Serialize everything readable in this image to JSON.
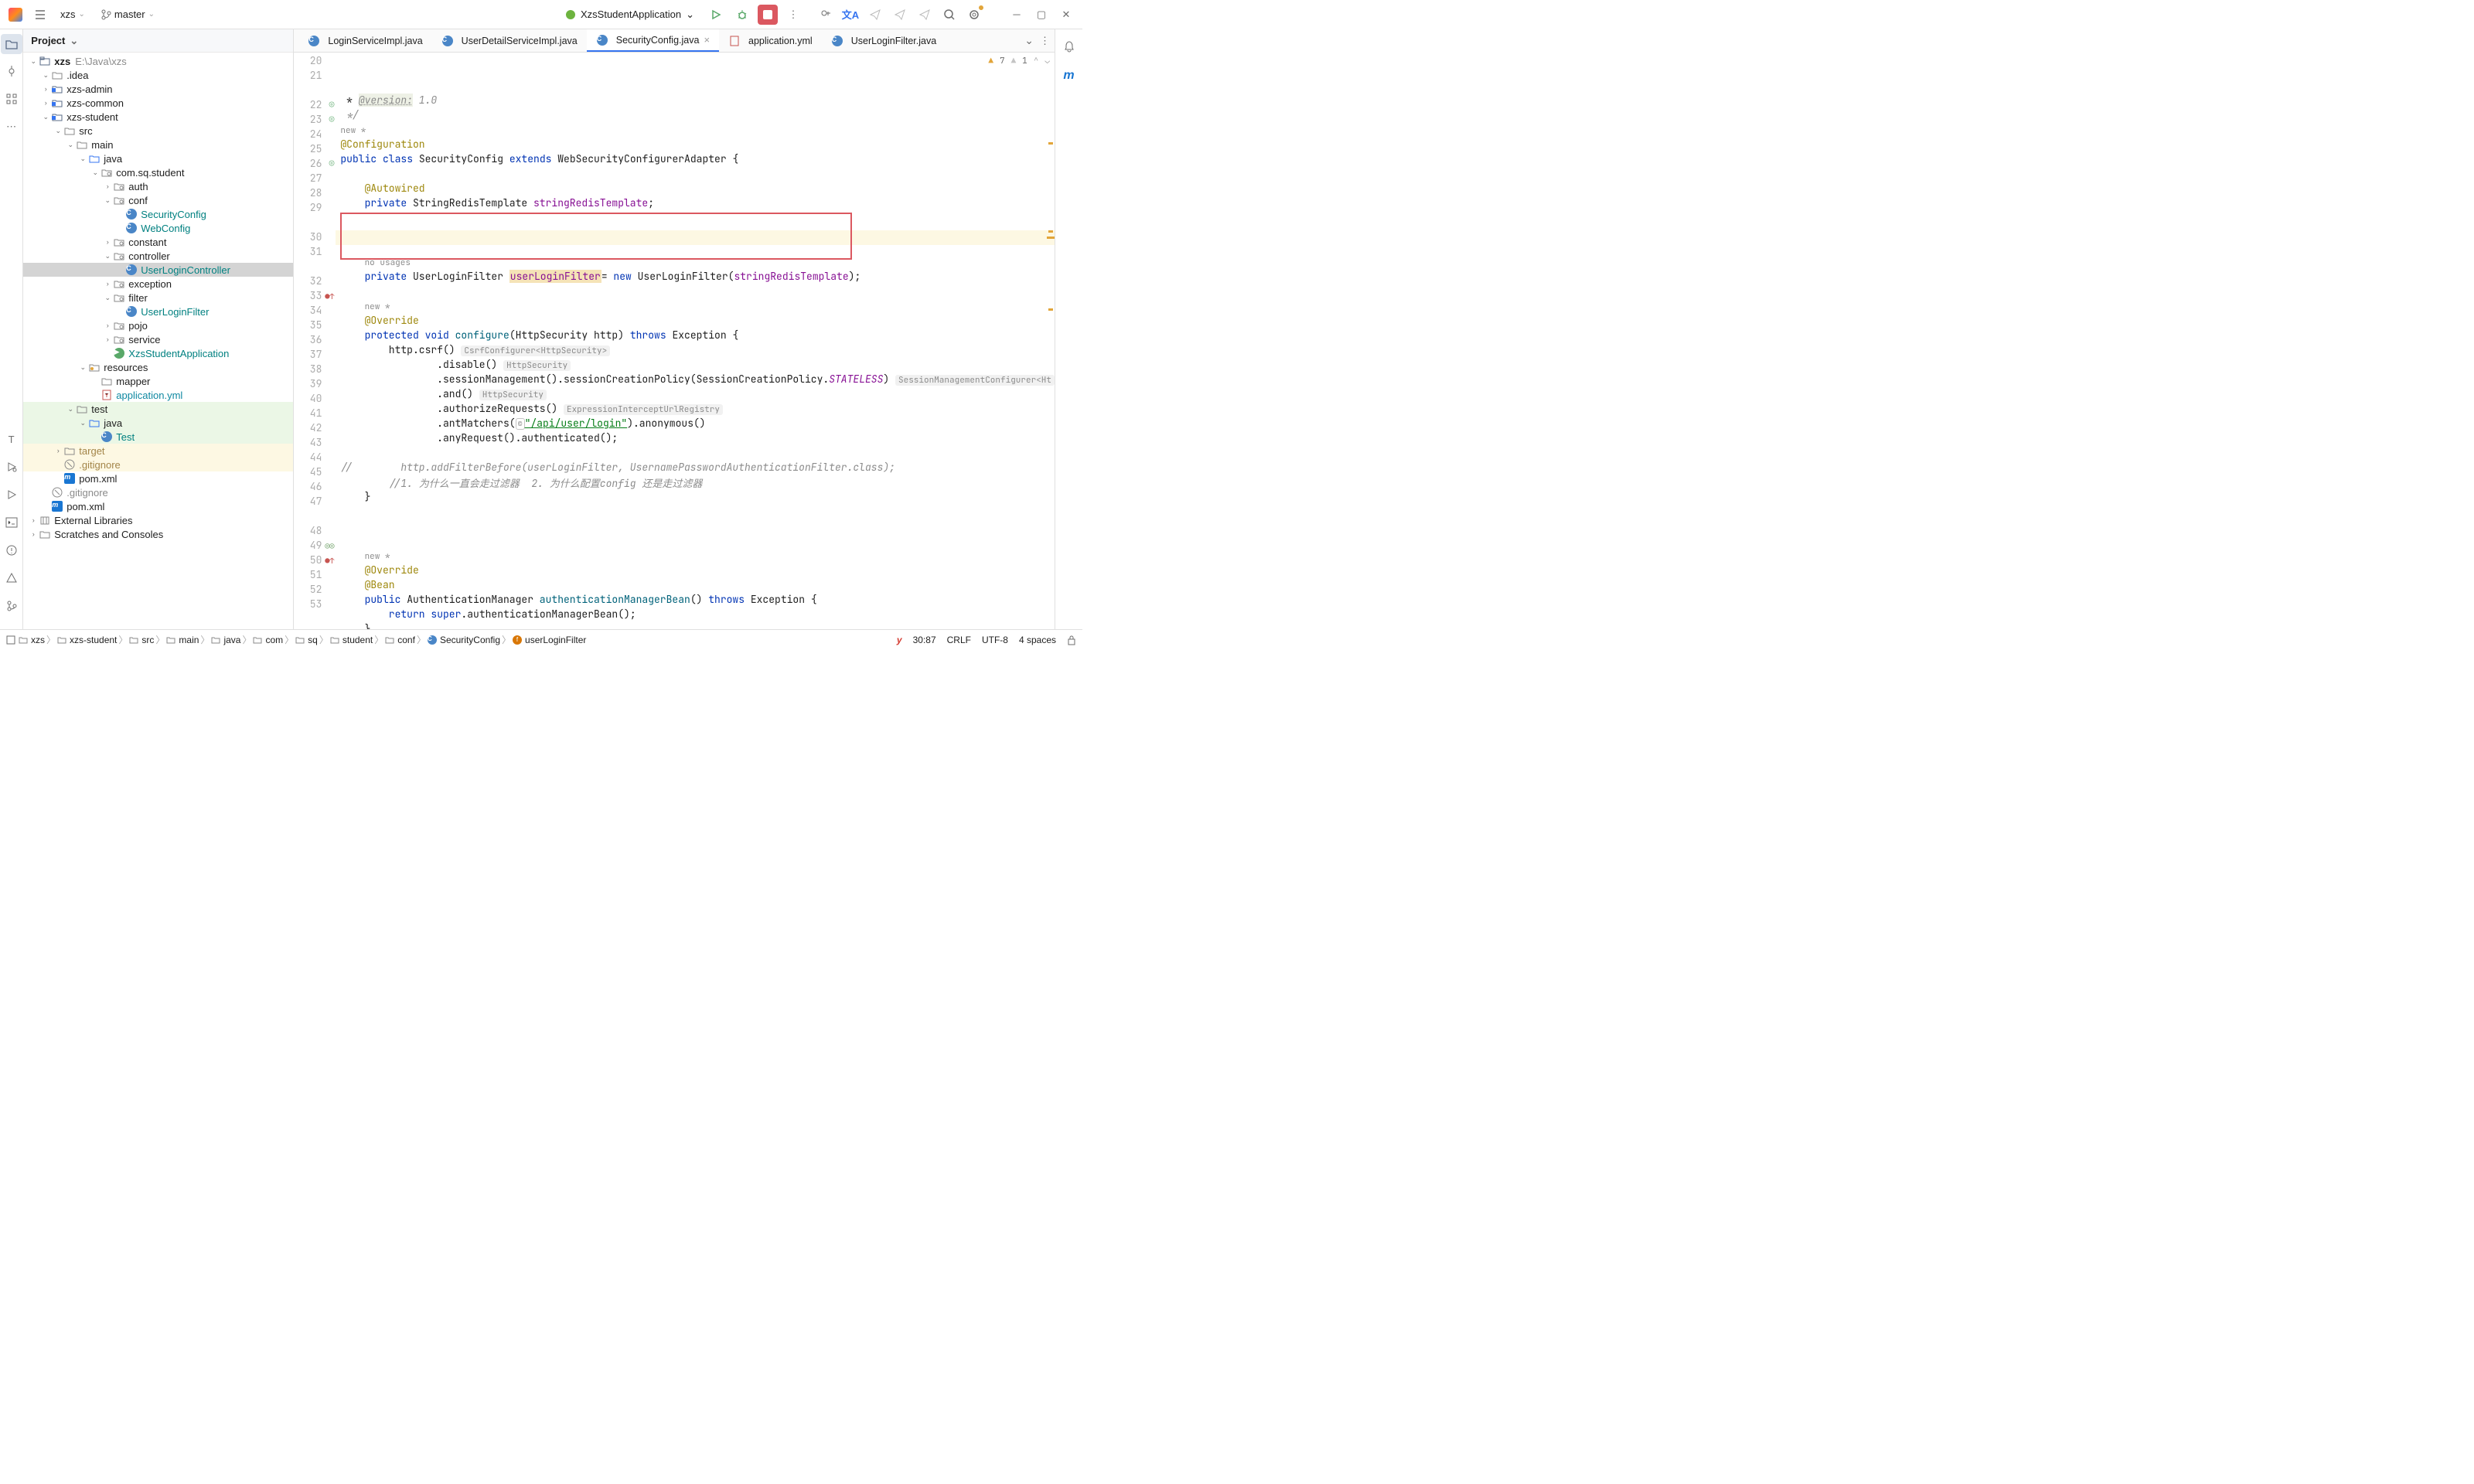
{
  "toolbar": {
    "project_name": "xzs",
    "branch": "master",
    "run_config": "XzsStudentApplication"
  },
  "project_panel": {
    "title": "Project",
    "root_label": "xzs",
    "root_path": "E:\\Java\\xzs",
    "external_libs": "External Libraries",
    "scratches": "Scratches and Consoles"
  },
  "tree": [
    {
      "d": 1,
      "a": "v",
      "ic": "folder",
      "txt": ".idea",
      "cls": ""
    },
    {
      "d": 1,
      "a": ">",
      "ic": "mod",
      "txt": "xzs-admin",
      "cls": ""
    },
    {
      "d": 1,
      "a": ">",
      "ic": "mod",
      "txt": "xzs-common",
      "cls": ""
    },
    {
      "d": 1,
      "a": "v",
      "ic": "mod",
      "txt": "xzs-student",
      "cls": ""
    },
    {
      "d": 2,
      "a": "v",
      "ic": "folder",
      "txt": "src",
      "cls": ""
    },
    {
      "d": 3,
      "a": "v",
      "ic": "folder",
      "txt": "main",
      "cls": ""
    },
    {
      "d": 4,
      "a": "v",
      "ic": "srcfolder",
      "txt": "java",
      "cls": ""
    },
    {
      "d": 5,
      "a": "v",
      "ic": "pkg",
      "txt": "com.sq.student",
      "cls": ""
    },
    {
      "d": 6,
      "a": ">",
      "ic": "pkg",
      "txt": "auth",
      "cls": ""
    },
    {
      "d": 6,
      "a": "v",
      "ic": "pkg",
      "txt": "conf",
      "cls": ""
    },
    {
      "d": 7,
      "a": "",
      "ic": "class",
      "txt": "SecurityConfig",
      "cls": "teal"
    },
    {
      "d": 7,
      "a": "",
      "ic": "class",
      "txt": "WebConfig",
      "cls": "teal"
    },
    {
      "d": 6,
      "a": ">",
      "ic": "pkg",
      "txt": "constant",
      "cls": ""
    },
    {
      "d": 6,
      "a": "v",
      "ic": "pkg",
      "txt": "controller",
      "cls": ""
    },
    {
      "d": 7,
      "a": "",
      "ic": "class",
      "txt": "UserLoginController",
      "cls": "teal selected"
    },
    {
      "d": 6,
      "a": ">",
      "ic": "pkg",
      "txt": "exception",
      "cls": ""
    },
    {
      "d": 6,
      "a": "v",
      "ic": "pkg",
      "txt": "filter",
      "cls": ""
    },
    {
      "d": 7,
      "a": "",
      "ic": "class",
      "txt": "UserLoginFilter",
      "cls": "teal"
    },
    {
      "d": 6,
      "a": ">",
      "ic": "pkg",
      "txt": "pojo",
      "cls": ""
    },
    {
      "d": 6,
      "a": ">",
      "ic": "pkg",
      "txt": "service",
      "cls": ""
    },
    {
      "d": 6,
      "a": "",
      "ic": "app",
      "txt": "XzsStudentApplication",
      "cls": "teal"
    },
    {
      "d": 4,
      "a": "v",
      "ic": "resfolder",
      "txt": "resources",
      "cls": ""
    },
    {
      "d": 5,
      "a": "",
      "ic": "folder",
      "txt": "mapper",
      "cls": ""
    },
    {
      "d": 5,
      "a": "",
      "ic": "yaml",
      "txt": "application.yml",
      "cls": "cyan"
    },
    {
      "d": 3,
      "a": "v",
      "ic": "folder",
      "txt": "test",
      "cls": "green"
    },
    {
      "d": 4,
      "a": "v",
      "ic": "srcfolder",
      "txt": "java",
      "cls": "green"
    },
    {
      "d": 5,
      "a": "",
      "ic": "class",
      "txt": "Test",
      "cls": "teal green"
    },
    {
      "d": 2,
      "a": ">",
      "ic": "folder",
      "txt": "target",
      "cls": "ignored yellow"
    },
    {
      "d": 2,
      "a": "",
      "ic": "git",
      "txt": ".gitignore",
      "cls": "ignored yellow"
    },
    {
      "d": 2,
      "a": "",
      "ic": "maven",
      "txt": "pom.xml",
      "cls": ""
    },
    {
      "d": 1,
      "a": "",
      "ic": "git",
      "txt": ".gitignore",
      "cls": "grey"
    },
    {
      "d": 1,
      "a": "",
      "ic": "maven",
      "txt": "pom.xml",
      "cls": ""
    }
  ],
  "tabs": [
    {
      "label": "LoginServiceImpl.java",
      "icon": "class",
      "active": false
    },
    {
      "label": "UserDetailServiceImpl.java",
      "icon": "class",
      "active": false
    },
    {
      "label": "SecurityConfig.java",
      "icon": "class",
      "active": true
    },
    {
      "label": "application.yml",
      "icon": "yaml",
      "active": false
    },
    {
      "label": "UserLoginFilter.java",
      "icon": "class",
      "active": false
    }
  ],
  "inspections": {
    "warnings": "7",
    "weak": "1"
  },
  "code_lines": [
    {
      "n": 20,
      "html": " * <span style='background:#eef1e6;color:#8c8c8c;text-decoration:underline dotted;font-style:italic'>@version:</span><span class='com'> 1.0</span>"
    },
    {
      "n": 21,
      "html": "<span class='com'> */</span>"
    },
    {
      "n": null,
      "html": "<span class='newstar'>new *</span>"
    },
    {
      "n": 22,
      "gut": "green-run",
      "html": "<span class='ann'>@Configuration</span>"
    },
    {
      "n": 23,
      "gut": "green-run",
      "html": "<span class='kw'>public</span> <span class='kw'>class</span> SecurityConfig <span class='kw'>extends</span> WebSecurityConfigurerAdapter {"
    },
    {
      "n": 24,
      "html": ""
    },
    {
      "n": 25,
      "html": "    <span class='ann'>@Autowired</span>"
    },
    {
      "n": 26,
      "gut": "green-run",
      "html": "    <span class='kw'>private</span> StringRedisTemplate <span class='field'>stringRedisTemplate</span>;"
    },
    {
      "n": 27,
      "html": ""
    },
    {
      "n": 28,
      "html": ""
    },
    {
      "n": 29,
      "html": ""
    },
    {
      "n": null,
      "hl": true,
      "html": "    <span class='usages'>no usages</span>"
    },
    {
      "n": 30,
      "hl": true,
      "bulb": true,
      "html": "    <span class='kw'>private</span> UserLoginFilter <span class='hl-token field'>userLoginFilter</span>= <span class='kw'>new</span> UserLoginFilter(<span class='field'>stringRedisTemplate</span>);",
      "lineY": true
    },
    {
      "n": 31,
      "hl": true,
      "html": ""
    },
    {
      "n": null,
      "html": "    <span class='newstar'>new *</span>"
    },
    {
      "n": 32,
      "html": "    <span class='ann'>@Override</span>"
    },
    {
      "n": 33,
      "gut": "impl",
      "html": "    <span class='kw'>protected</span> <span class='kw'>void</span> <span class='method'>configure</span>(HttpSecurity http) <span class='kw'>throws</span> Exception {"
    },
    {
      "n": 34,
      "html": "        http.csrf() <span class='hint'>CsrfConfigurer&lt;HttpSecurity&gt;</span>"
    },
    {
      "n": 35,
      "html": "                .disable() <span class='hint'>HttpSecurity</span>"
    },
    {
      "n": 36,
      "html": "                .sessionManagement().sessionCreationPolicy(SessionCreationPolicy.<span class='field' style='font-style:italic'>STATELESS</span>) <span class='hint'>SessionManagementConfigurer&lt;Ht</span>"
    },
    {
      "n": 37,
      "html": "                .and() <span class='hint'>HttpSecurity</span>"
    },
    {
      "n": 38,
      "html": "                .authorizeRequests() <span class='hint'>ExpressionInterceptUrlRegistry</span>"
    },
    {
      "n": 39,
      "html": "                .antMatchers(<span style='border:1px solid #c4c4c4;border-radius:3px;padding:0 2px;font-size:10px;color:#888'>©</span><span class='str link-u'>\"/api/user/login\"</span>).anonymous()"
    },
    {
      "n": 40,
      "html": "                .anyRequest().authenticated();"
    },
    {
      "n": 41,
      "html": ""
    },
    {
      "n": 42,
      "html": "<span class='com'>//        http.addFilterBefore(userLoginFilter, UsernamePasswordAuthenticationFilter.class);</span>"
    },
    {
      "n": 43,
      "html": "        <span class='com'>//1. 为什么一直会走过滤器  2. 为什么配置config 还是走过滤器</span>"
    },
    {
      "n": 44,
      "html": "    }"
    },
    {
      "n": 45,
      "html": ""
    },
    {
      "n": 46,
      "html": ""
    },
    {
      "n": 47,
      "html": ""
    },
    {
      "n": null,
      "html": "    <span class='newstar'>new *</span>"
    },
    {
      "n": 48,
      "html": "    <span class='ann'>@Override</span>"
    },
    {
      "n": 49,
      "gut": "impl2",
      "html": "    <span class='ann'>@Bean</span>"
    },
    {
      "n": 50,
      "gut": "impl",
      "html": "    <span class='kw'>public</span> AuthenticationManager <span class='method'>authenticationManagerBean</span>() <span class='kw'>throws</span> Exception {"
    },
    {
      "n": 51,
      "html": "        <span class='kw'>return</span> <span class='kw'>super</span>.authenticationManagerBean();"
    },
    {
      "n": 52,
      "html": "    }"
    },
    {
      "n": 53,
      "html": ""
    },
    {
      "n": null,
      "html": "    <span class='newstar'>new *</span>"
    }
  ],
  "breadcrumbs": [
    "xzs",
    "xzs-student",
    "src",
    "main",
    "java",
    "com",
    "sq",
    "student",
    "conf",
    "SecurityConfig",
    "userLoginFilter"
  ],
  "statusbar": {
    "pos": "30:87",
    "line_sep": "CRLF",
    "encoding": "UTF-8",
    "indent": "4 spaces"
  }
}
